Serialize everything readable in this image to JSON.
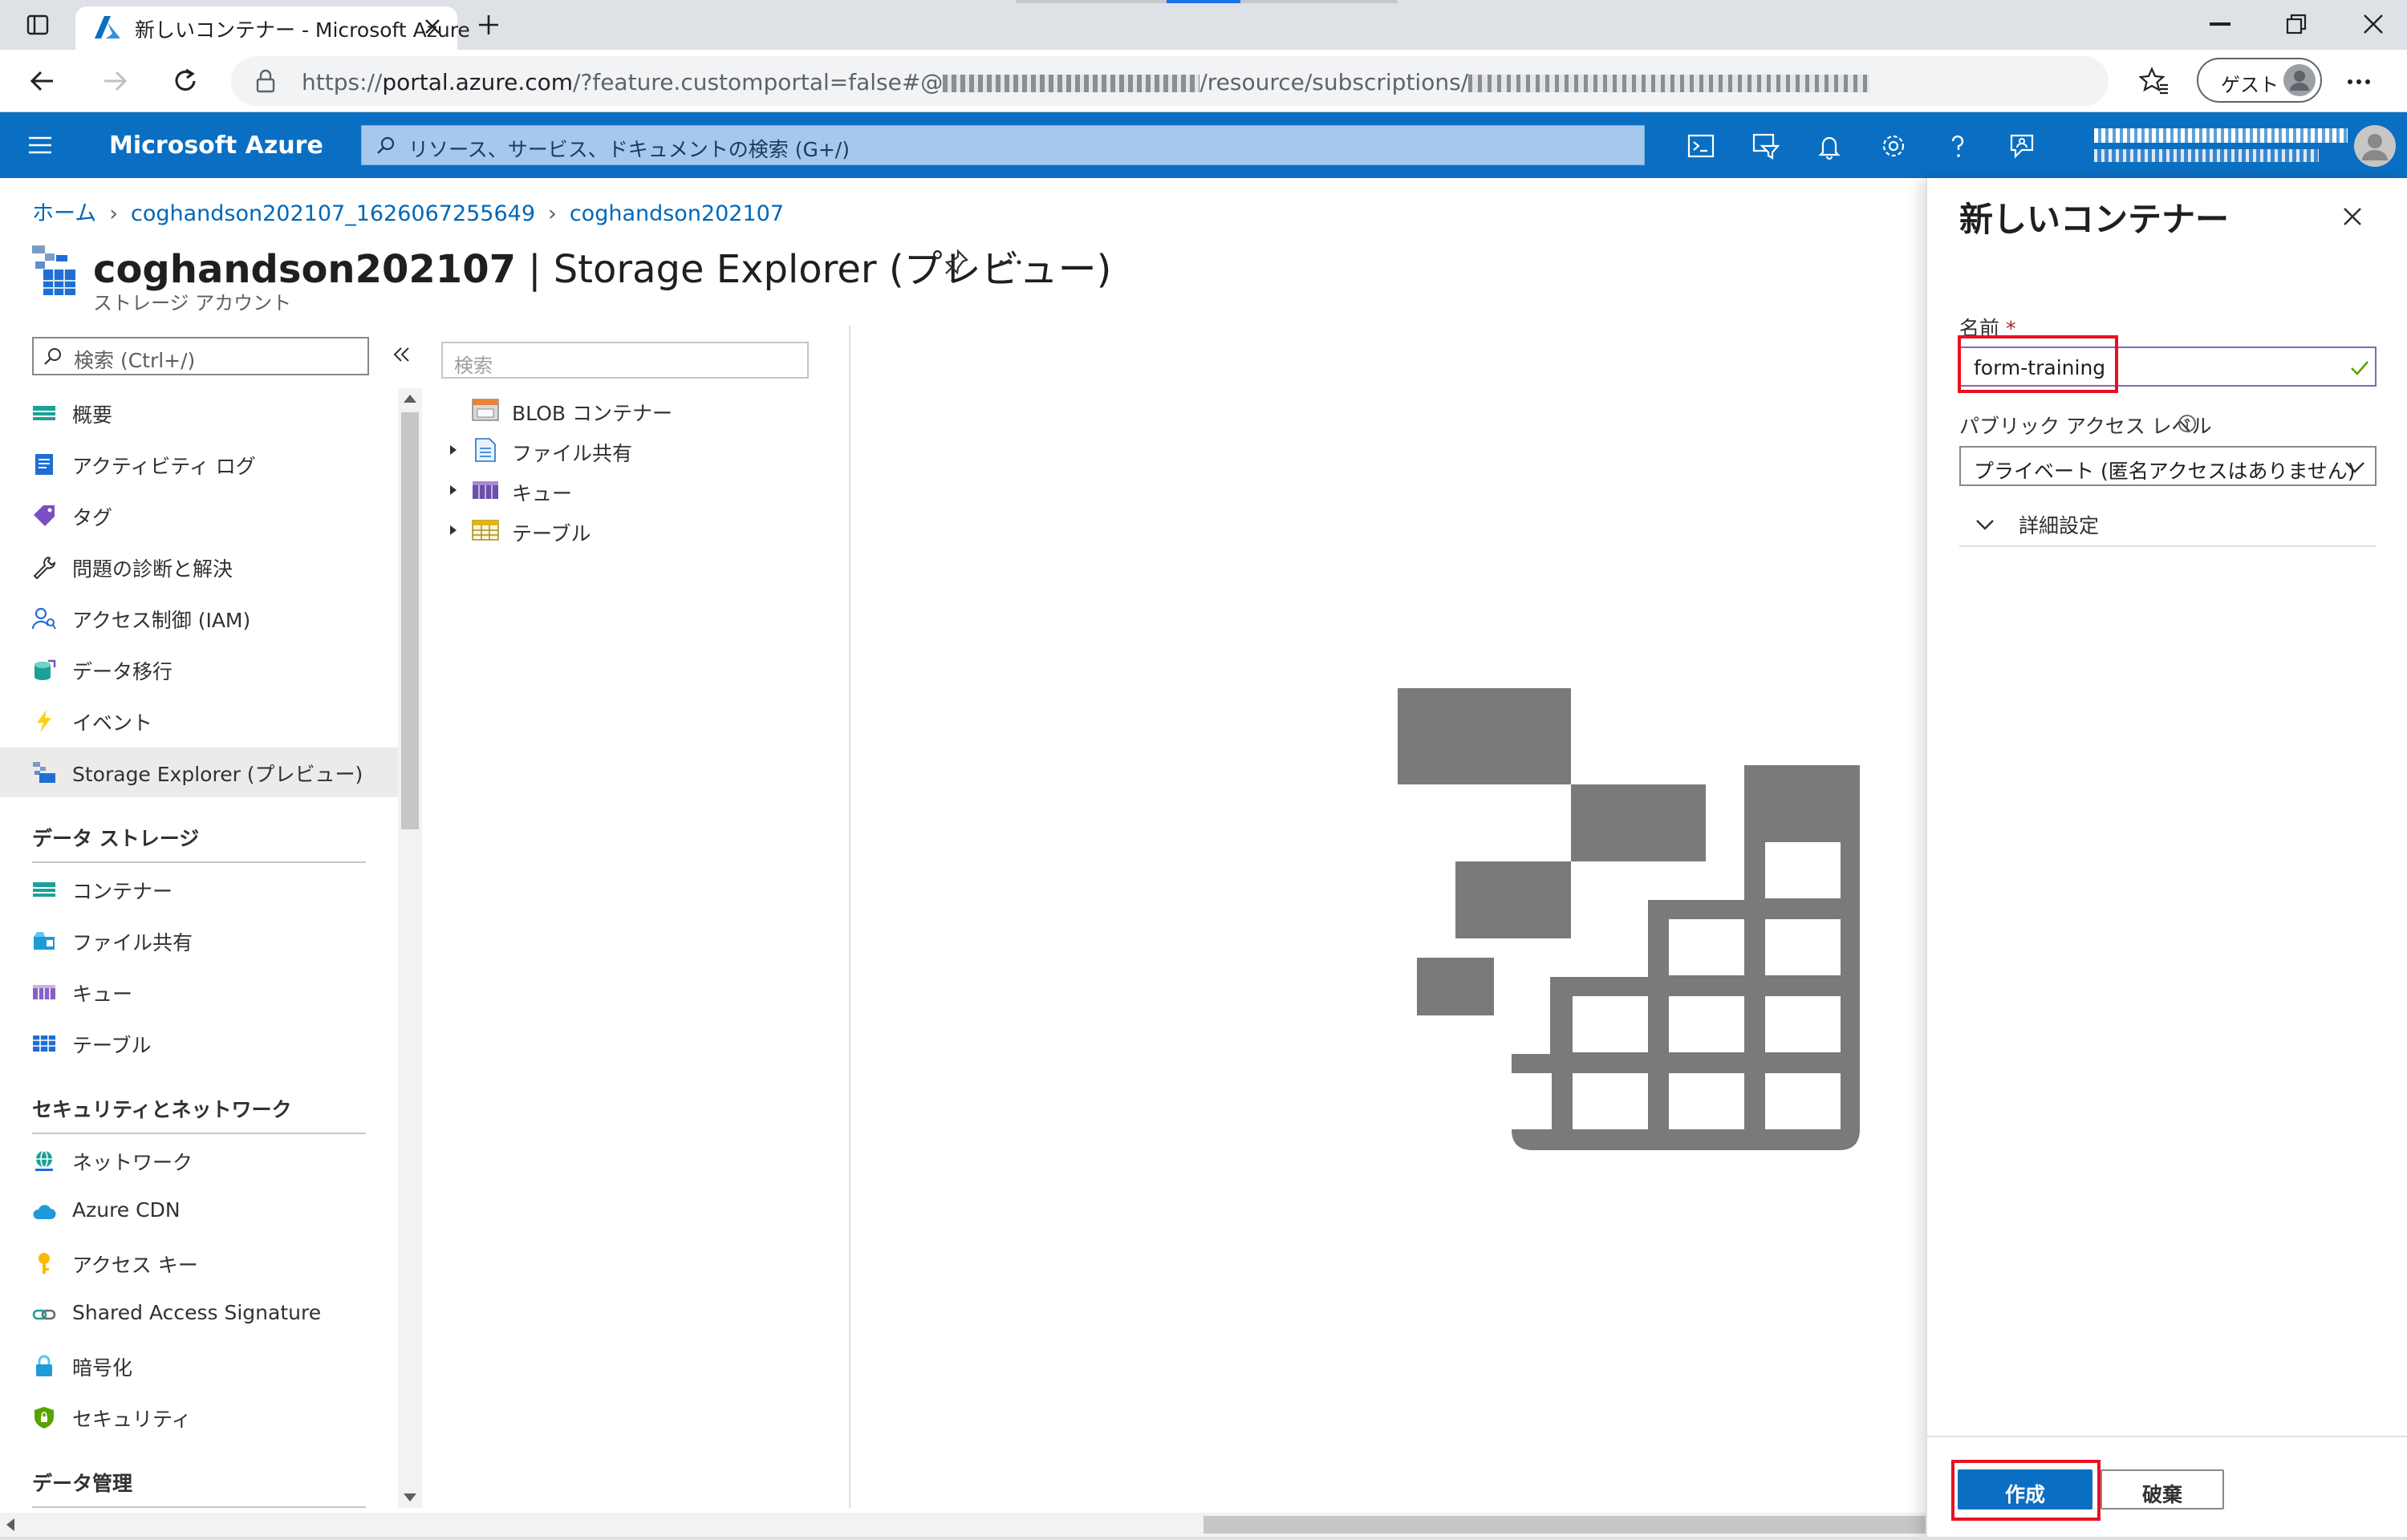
{
  "browser": {
    "tab_title": "新しいコンテナー - Microsoft Azure",
    "url_prefix": "https://",
    "url_host": "portal.azure.com",
    "url_rest": "/?feature.customportal=false#@",
    "url_resource": "/resource/subscriptions/",
    "guest_label": "ゲスト"
  },
  "header": {
    "brand": "Microsoft Azure",
    "search_placeholder": "リソース、サービス、ドキュメントの検索 (G+/)"
  },
  "breadcrumb": [
    "ホーム",
    "coghandson202107_1626067255649",
    "coghandson202107"
  ],
  "page": {
    "title_bold": "coghandson202107",
    "title_rest": " | Storage Explorer (プレビュー)",
    "subtitle": "ストレージ アカウント"
  },
  "nav": {
    "search_placeholder": "検索 (Ctrl+/)",
    "items": [
      {
        "label": "概要",
        "icon": "overview-icon"
      },
      {
        "label": "アクティビティ ログ",
        "icon": "activity-log-icon"
      },
      {
        "label": "タグ",
        "icon": "tag-icon"
      },
      {
        "label": "問題の診断と解決",
        "icon": "wrench-icon"
      },
      {
        "label": "アクセス制御 (IAM)",
        "icon": "iam-icon"
      },
      {
        "label": "データ移行",
        "icon": "data-migration-icon"
      },
      {
        "label": "イベント",
        "icon": "lightning-icon"
      },
      {
        "label": "Storage Explorer (プレビュー)",
        "icon": "storage-explorer-icon"
      }
    ],
    "section_data_storage": "データ ストレージ",
    "data_storage_items": [
      {
        "label": "コンテナー",
        "icon": "container-icon"
      },
      {
        "label": "ファイル共有",
        "icon": "file-share-icon"
      },
      {
        "label": "キュー",
        "icon": "queue-icon"
      },
      {
        "label": "テーブル",
        "icon": "table-icon"
      }
    ],
    "section_security": "セキュリティとネットワーク",
    "security_items": [
      {
        "label": "ネットワーク",
        "icon": "network-icon"
      },
      {
        "label": "Azure CDN",
        "icon": "cloud-icon"
      },
      {
        "label": "アクセス キー",
        "icon": "key-icon"
      },
      {
        "label": "Shared Access Signature",
        "icon": "link-icon"
      },
      {
        "label": "暗号化",
        "icon": "lock-icon"
      },
      {
        "label": "セキュリティ",
        "icon": "shield-icon"
      }
    ],
    "section_data_mgmt": "データ管理"
  },
  "tree": {
    "search_placeholder": "検索",
    "items": [
      {
        "label": "BLOB コンテナー",
        "expandable": false
      },
      {
        "label": "ファイル共有",
        "expandable": true
      },
      {
        "label": "キュー",
        "expandable": true
      },
      {
        "label": "テーブル",
        "expandable": true
      }
    ]
  },
  "panel": {
    "title": "新しいコンテナー",
    "name_label": "名前",
    "required_mark": "*",
    "name_value": "form-training",
    "access_label": "パブリック アクセス レベル",
    "access_value": "プライベート (匿名アクセスはありません)",
    "advanced_label": "詳細設定",
    "create_label": "作成",
    "discard_label": "破棄"
  },
  "colors": {
    "azure_blue": "#0a6fc2",
    "highlight_red": "#e81123",
    "input_focus": "#8764b8"
  }
}
